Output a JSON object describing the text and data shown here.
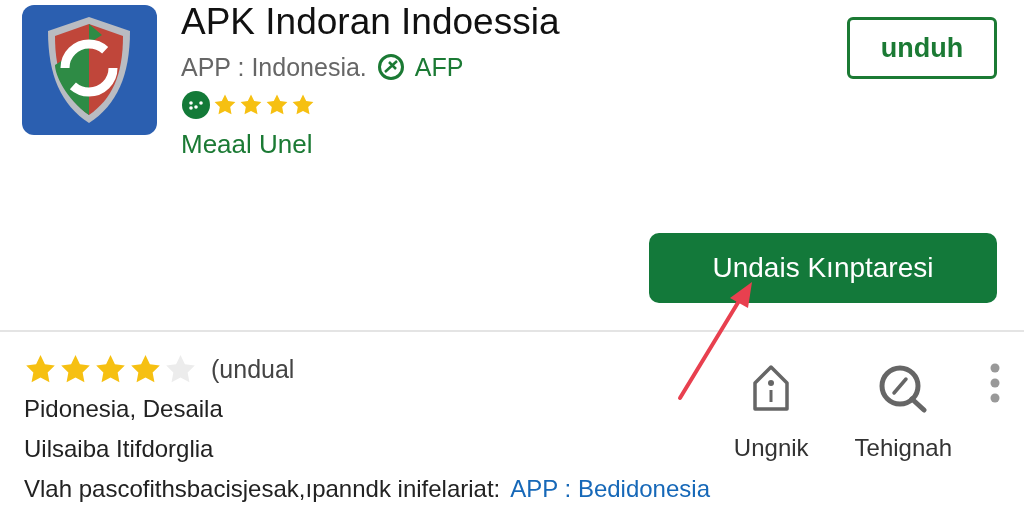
{
  "app": {
    "title": "APK Indoran Indoessia",
    "publisher": "APP : Indonesia.",
    "badge": "AFP",
    "stars": 4,
    "category": "Meaal Unel"
  },
  "install_button": "unduh",
  "primary_button": "Undais Kınptaresi",
  "details": {
    "stars": 4,
    "rating_label": "(undual",
    "lines": [
      "Pidonesia, Desaila",
      "Uilsaiba Itifdorglia"
    ],
    "footer_text": "Vlah pascofithsbacisjesak,ıpanndk inifelariat:",
    "footer_link": "APP : Bedidonesia"
  },
  "actions": [
    {
      "label": "Ungnik",
      "kind": "house"
    },
    {
      "label": "Tehignah",
      "kind": "search"
    }
  ]
}
